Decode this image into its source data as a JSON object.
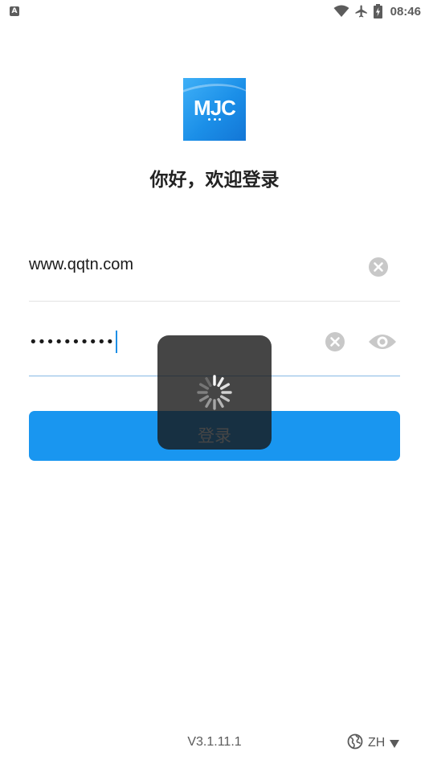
{
  "status_bar": {
    "notification_badge": "A",
    "icons": [
      "wifi-icon",
      "airplane-icon",
      "battery-charging-icon"
    ],
    "time": "08:46"
  },
  "header": {
    "logo_text": "MJC",
    "welcome": "你好，欢迎登录"
  },
  "form": {
    "account": {
      "value": "www.qqtn.com",
      "clear_icon": "clear-icon"
    },
    "password": {
      "masked_value": "••••••••••",
      "clear_icon": "clear-icon",
      "visibility_icon": "eye-icon"
    },
    "login_label": "登录"
  },
  "overlay": {
    "spinner_icon": "spinner-icon"
  },
  "footer": {
    "version": "V3.1.11.1",
    "language": "ZH",
    "language_icon": "globe-icon",
    "dropdown_icon": "triangle-down-icon"
  },
  "colors": {
    "accent": "#1996f0",
    "overlay": "#161616",
    "icon_gray": "#c8c8c8",
    "text_gray": "#5a5a5a"
  }
}
